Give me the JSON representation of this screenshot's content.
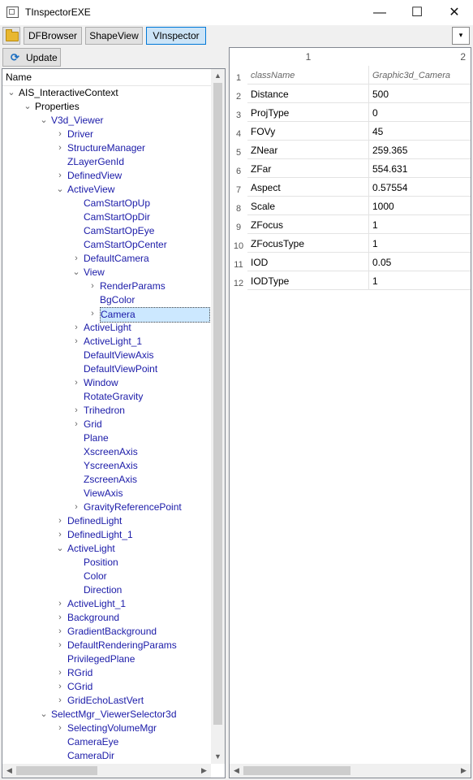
{
  "window": {
    "title": "TInspectorEXE",
    "controls": {
      "minimize": "—",
      "maximize": "☐",
      "close": "✕"
    }
  },
  "toolbar": {
    "open_icon": "folder-open-icon",
    "tabs": [
      {
        "label": "DFBrowser",
        "active": false
      },
      {
        "label": "ShapeView",
        "active": false
      },
      {
        "label": "VInspector",
        "active": true
      }
    ],
    "dropdown_glyph": "▾"
  },
  "update_button": {
    "label": "Update",
    "icon": "refresh-icon"
  },
  "tree": {
    "header": "Name",
    "rows": [
      {
        "label": "AIS_InteractiveContext",
        "level": 0,
        "expander": "open"
      },
      {
        "label": "Properties",
        "level": 1,
        "expander": "open"
      },
      {
        "label": "V3d_Viewer",
        "level": 2,
        "expander": "open"
      },
      {
        "label": "Driver",
        "level": 3,
        "expander": "closed"
      },
      {
        "label": "StructureManager",
        "level": 3,
        "expander": "closed"
      },
      {
        "label": "ZLayerGenId",
        "level": 3,
        "expander": "none"
      },
      {
        "label": "DefinedView",
        "level": 3,
        "expander": "closed"
      },
      {
        "label": "ActiveView",
        "level": 3,
        "expander": "open"
      },
      {
        "label": "CamStartOpUp",
        "level": 4,
        "expander": "none"
      },
      {
        "label": "CamStartOpDir",
        "level": 4,
        "expander": "none"
      },
      {
        "label": "CamStartOpEye",
        "level": 4,
        "expander": "none"
      },
      {
        "label": "CamStartOpCenter",
        "level": 4,
        "expander": "none"
      },
      {
        "label": "DefaultCamera",
        "level": 4,
        "expander": "closed"
      },
      {
        "label": "View",
        "level": 4,
        "expander": "open"
      },
      {
        "label": "RenderParams",
        "level": 5,
        "expander": "closed"
      },
      {
        "label": "BgColor",
        "level": 5,
        "expander": "none"
      },
      {
        "label": "Camera",
        "level": 5,
        "expander": "closed",
        "selected": true
      },
      {
        "label": "ActiveLight",
        "level": 4,
        "expander": "closed"
      },
      {
        "label": "ActiveLight_1",
        "level": 4,
        "expander": "closed"
      },
      {
        "label": "DefaultViewAxis",
        "level": 4,
        "expander": "none"
      },
      {
        "label": "DefaultViewPoint",
        "level": 4,
        "expander": "none"
      },
      {
        "label": "Window",
        "level": 4,
        "expander": "closed"
      },
      {
        "label": "RotateGravity",
        "level": 4,
        "expander": "none"
      },
      {
        "label": "Trihedron",
        "level": 4,
        "expander": "closed"
      },
      {
        "label": "Grid",
        "level": 4,
        "expander": "closed"
      },
      {
        "label": "Plane",
        "level": 4,
        "expander": "none"
      },
      {
        "label": "XscreenAxis",
        "level": 4,
        "expander": "none"
      },
      {
        "label": "YscreenAxis",
        "level": 4,
        "expander": "none"
      },
      {
        "label": "ZscreenAxis",
        "level": 4,
        "expander": "none"
      },
      {
        "label": "ViewAxis",
        "level": 4,
        "expander": "none"
      },
      {
        "label": "GravityReferencePoint",
        "level": 4,
        "expander": "closed"
      },
      {
        "label": "DefinedLight",
        "level": 3,
        "expander": "closed"
      },
      {
        "label": "DefinedLight_1",
        "level": 3,
        "expander": "closed"
      },
      {
        "label": "ActiveLight",
        "level": 3,
        "expander": "open"
      },
      {
        "label": "Position",
        "level": 4,
        "expander": "none"
      },
      {
        "label": "Color",
        "level": 4,
        "expander": "none"
      },
      {
        "label": "Direction",
        "level": 4,
        "expander": "none"
      },
      {
        "label": "ActiveLight_1",
        "level": 3,
        "expander": "closed"
      },
      {
        "label": "Background",
        "level": 3,
        "expander": "closed"
      },
      {
        "label": "GradientBackground",
        "level": 3,
        "expander": "closed"
      },
      {
        "label": "DefaultRenderingParams",
        "level": 3,
        "expander": "closed"
      },
      {
        "label": "PrivilegedPlane",
        "level": 3,
        "expander": "none"
      },
      {
        "label": "RGrid",
        "level": 3,
        "expander": "closed"
      },
      {
        "label": "CGrid",
        "level": 3,
        "expander": "closed"
      },
      {
        "label": "GridEchoLastVert",
        "level": 3,
        "expander": "closed"
      },
      {
        "label": "SelectMgr_ViewerSelector3d",
        "level": 2,
        "expander": "open"
      },
      {
        "label": "SelectingVolumeMgr",
        "level": 3,
        "expander": "closed"
      },
      {
        "label": "CameraEye",
        "level": 3,
        "expander": "none"
      },
      {
        "label": "CameraDir",
        "level": 3,
        "expander": "none"
      }
    ]
  },
  "table": {
    "column_headers": [
      "1",
      "2"
    ],
    "row_numbers": [
      "1",
      "2",
      "3",
      "4",
      "5",
      "6",
      "7",
      "8",
      "9",
      "10",
      "11",
      "12"
    ],
    "rows": [
      [
        "className",
        "Graphic3d_Camera"
      ],
      [
        "Distance",
        "500"
      ],
      [
        "ProjType",
        "0"
      ],
      [
        "FOVy",
        "45"
      ],
      [
        "ZNear",
        "259.365"
      ],
      [
        "ZFar",
        "554.631"
      ],
      [
        "Aspect",
        "0.57554"
      ],
      [
        "Scale",
        "1000"
      ],
      [
        "ZFocus",
        "1"
      ],
      [
        "ZFocusType",
        "1"
      ],
      [
        "IOD",
        "0.05"
      ],
      [
        "IODType",
        "1"
      ]
    ]
  },
  "scroll": {
    "up": "▲",
    "down": "▼",
    "left": "◀",
    "right": "▶"
  },
  "colors": {
    "tree_text": "#1a1aa8",
    "selection": "#cce8ff",
    "active_tab": "#cce4f7"
  }
}
